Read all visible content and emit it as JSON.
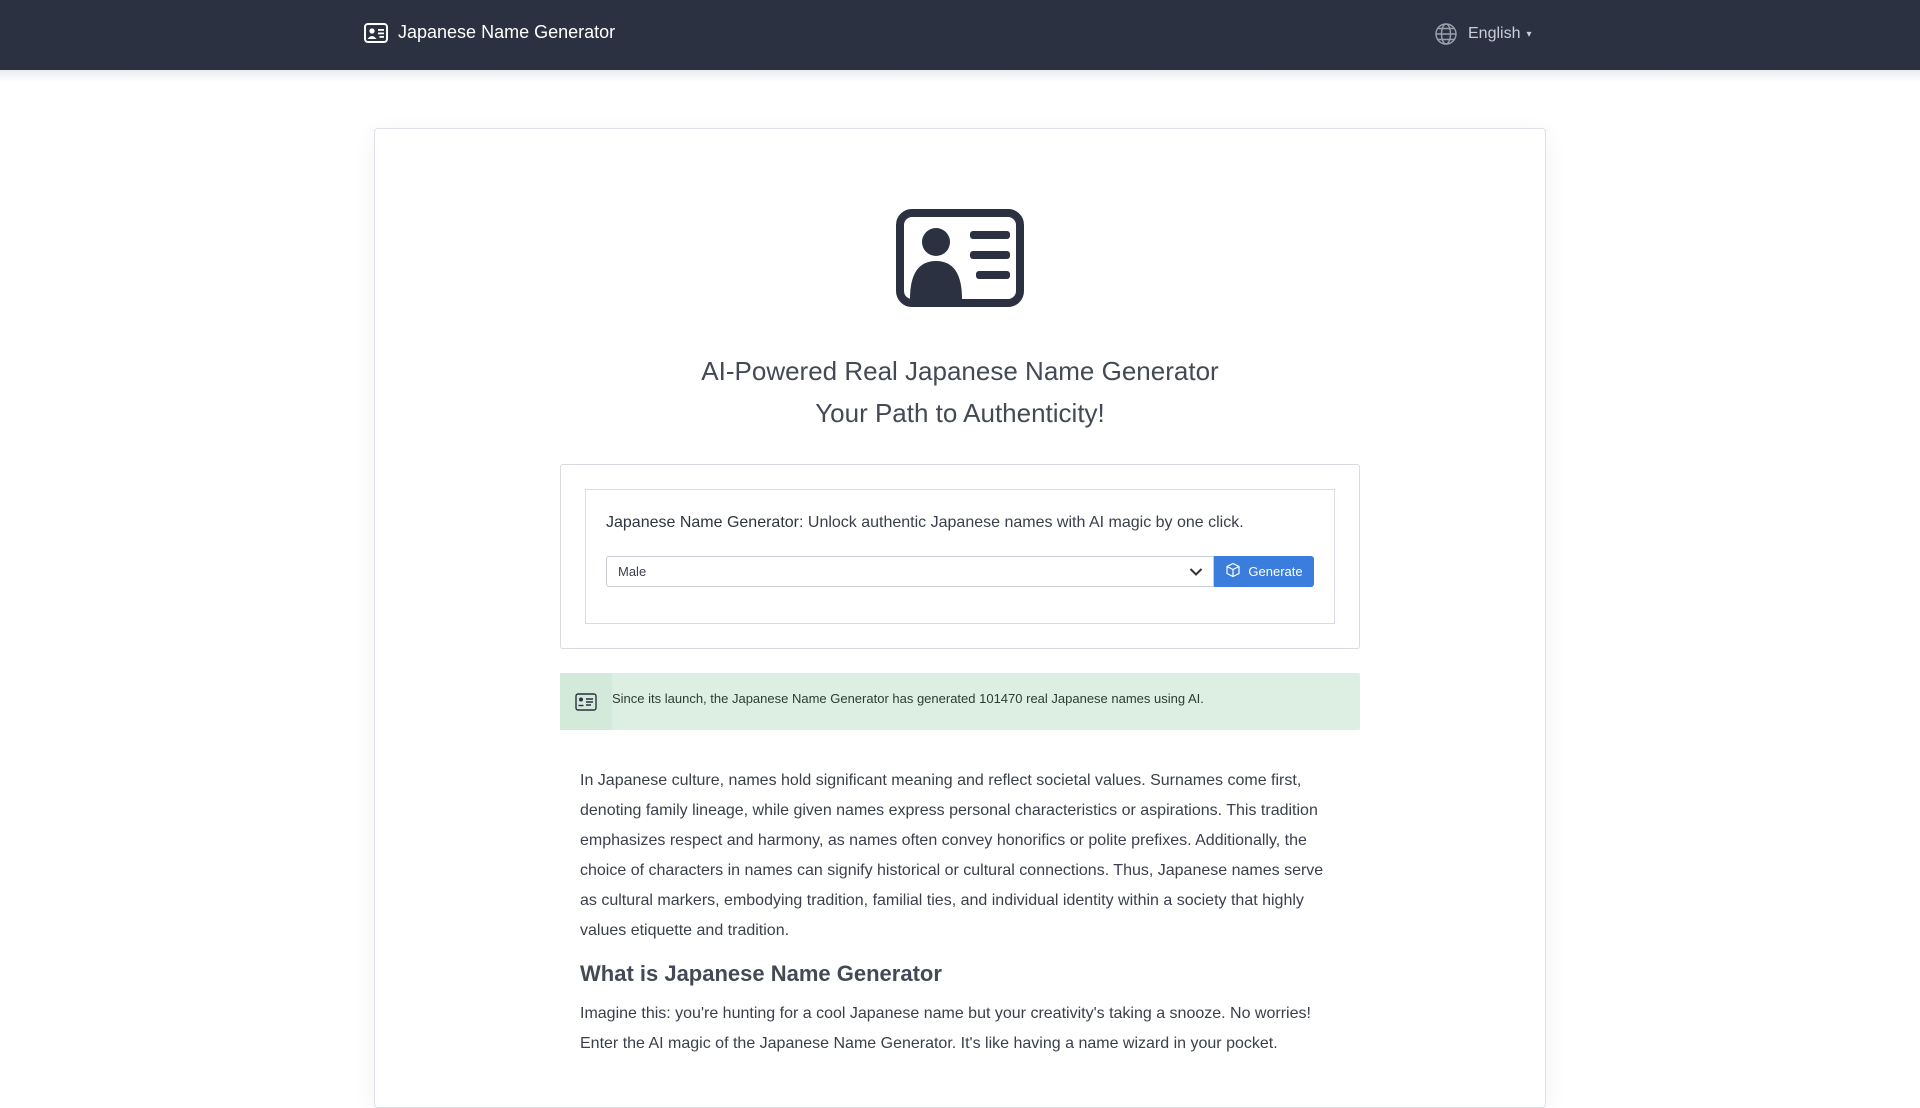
{
  "navbar": {
    "brand": "Japanese Name Generator",
    "language": "English"
  },
  "hero": {
    "title_line1": "AI-Powered Real Japanese Name Generator",
    "title_line2": "Your Path to Authenticity!"
  },
  "generator": {
    "label_bold": "Japanese Name Generator",
    "label_rest": ": Unlock authentic Japanese names with AI magic by one click.",
    "gender_selected": "Male",
    "button_label": "Generate"
  },
  "alert": {
    "text": "Since its launch, the Japanese Name Generator has generated 101470 real Japanese names using AI."
  },
  "article": {
    "intro": "In Japanese culture, names hold significant meaning and reflect societal values. Surnames come first, denoting family lineage, while given names express personal characteristics or aspirations. This tradition emphasizes respect and harmony, as names often convey honorifics or polite prefixes. Additionally, the choice of characters in names can signify historical or cultural connections. Thus, Japanese names serve as cultural markers, embodying tradition, familial ties, and individual identity within a society that highly values etiquette and tradition.",
    "heading": "What is Japanese Name Generator",
    "body": "Imagine this: you're hunting for a cool Japanese name but your creativity's taking a snooze. No worries! Enter the AI magic of the Japanese Name Generator. It's like having a name wizard in your pocket."
  },
  "colors": {
    "navbar_bg": "#2b3140",
    "button_bg": "#3b7ddd",
    "alert_bg": "#dcefe2"
  },
  "icons": {
    "brand": "id-card-icon",
    "language": "globe-icon",
    "hero": "id-card-icon",
    "generate": "cube-icon",
    "alert": "id-card-outline-icon"
  }
}
